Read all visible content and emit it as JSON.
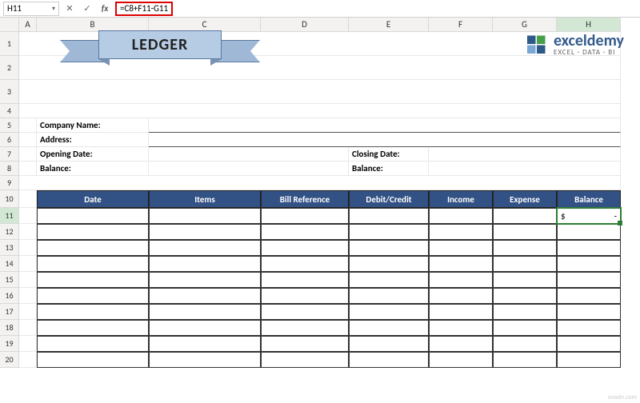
{
  "namebox": "H11",
  "formula": "=C8+F11-G11",
  "columns": [
    "A",
    "B",
    "C",
    "D",
    "E",
    "F",
    "G",
    "H"
  ],
  "rows": [
    "1",
    "2",
    "3",
    "4",
    "5",
    "6",
    "7",
    "8",
    "9",
    "10",
    "11",
    "12",
    "13",
    "14",
    "15",
    "16",
    "17",
    "18",
    "19",
    "20"
  ],
  "banner": {
    "title": "LEDGER"
  },
  "logo": {
    "name": "exceldemy",
    "tagline": "EXCEL · DATA · BI"
  },
  "form": {
    "company_label": "Company Name:",
    "address_label": "Address:",
    "opening_date_label": "Opening Date:",
    "opening_balance_label": "Balance:",
    "closing_date_label": "Closing Date:",
    "closing_balance_label": "Balance:"
  },
  "table": {
    "headers": [
      "Date",
      "Items",
      "Bill Reference",
      "Debit/Credit",
      "Income",
      "Expense",
      "Balance"
    ]
  },
  "selected": {
    "display": "$          -"
  },
  "watermark": "wsxdn.com",
  "chart_data": {
    "type": "table",
    "title": "LEDGER",
    "columns": [
      "Date",
      "Items",
      "Bill Reference",
      "Debit/Credit",
      "Income",
      "Expense",
      "Balance"
    ],
    "rows": [
      {
        "Date": "",
        "Items": "",
        "Bill Reference": "",
        "Debit/Credit": "",
        "Income": "",
        "Expense": "",
        "Balance": "$ -"
      }
    ]
  }
}
